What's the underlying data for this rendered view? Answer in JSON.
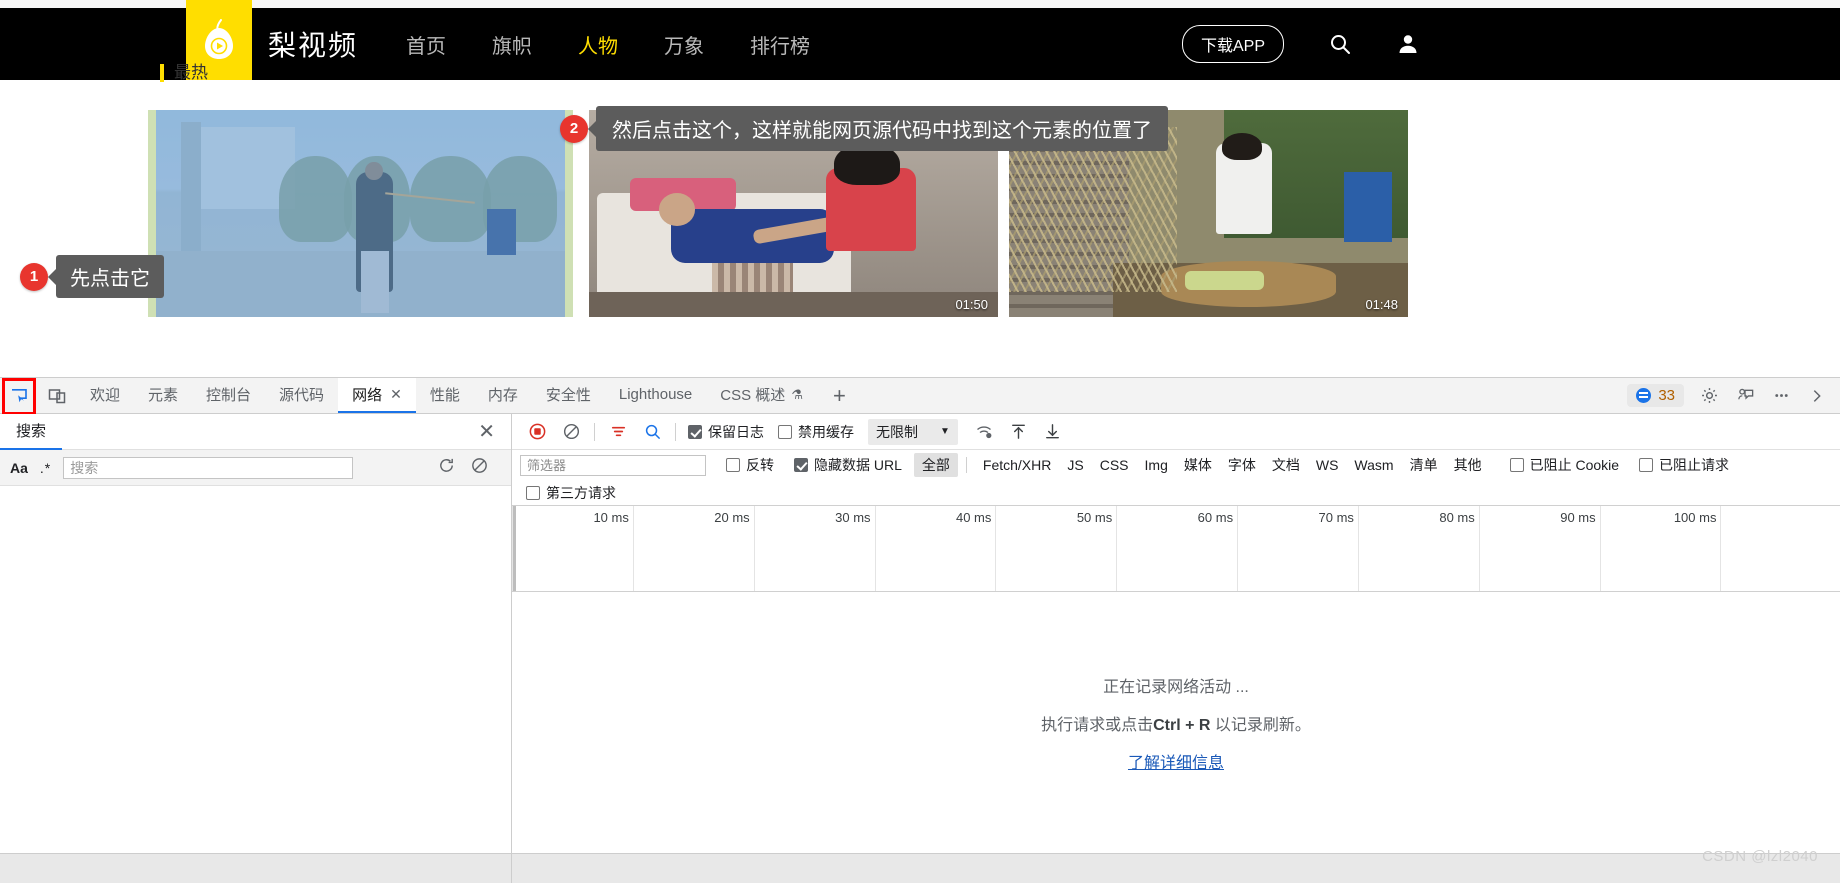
{
  "site": {
    "brand": "梨视频",
    "logo_icon": "pear-logo-icon",
    "nav": [
      {
        "label": "首页",
        "active": false
      },
      {
        "label": "旗帜",
        "active": false
      },
      {
        "label": "人物",
        "active": true
      },
      {
        "label": "万象",
        "active": false
      },
      {
        "label": "排行榜",
        "active": false
      }
    ],
    "download_app": "下载APP",
    "search_icon": "search-icon",
    "user_icon": "user-avatar-icon",
    "section_label": "最热",
    "thumbnails": [
      {
        "alt": "公园男子甩鞭视频缩略图",
        "duration": ""
      },
      {
        "alt": "照料卧床老人视频缩略图",
        "duration": "01:50"
      },
      {
        "alt": "农家院落男孩吃饭视频缩略图",
        "duration": "01:48"
      }
    ]
  },
  "annotations": [
    {
      "number": "1",
      "text": "先点击它"
    },
    {
      "number": "2",
      "text": "然后点击这个，这样就能网页源代码中找到这个元素的位置了"
    }
  ],
  "devtools": {
    "inspect_icon": "inspect-element-icon",
    "device_icon": "device-toolbar-icon",
    "tabs": [
      {
        "label": "欢迎",
        "active": false,
        "closable": false
      },
      {
        "label": "元素",
        "active": false,
        "closable": false
      },
      {
        "label": "控制台",
        "active": false,
        "closable": false
      },
      {
        "label": "源代码",
        "active": false,
        "closable": false
      },
      {
        "label": "网络",
        "active": true,
        "closable": true,
        "close_glyph": "✕"
      },
      {
        "label": "性能",
        "active": false,
        "closable": false
      },
      {
        "label": "内存",
        "active": false,
        "closable": false
      },
      {
        "label": "安全性",
        "active": false,
        "closable": false
      },
      {
        "label": "Lighthouse",
        "active": false,
        "closable": false
      },
      {
        "label": "CSS 概述",
        "active": false,
        "closable": false,
        "flask": "⚗"
      }
    ],
    "add_tab_glyph": "+",
    "issues": {
      "count": "33",
      "icon": "issues-bubble-icon"
    },
    "settings_icon": "gear-icon",
    "feedback_icon": "feedback-icon",
    "more_icon": "more-options-icon",
    "close_devtools_icon": "close-devtools-icon",
    "search_panel": {
      "tab_label": "搜索",
      "close_glyph": "✕",
      "match_case_label": "Aa",
      "regex_label": ".*",
      "input_value": "",
      "input_placeholder": "搜索",
      "refresh_icon": "refresh-icon",
      "clear_icon": "clear-icon"
    },
    "network": {
      "record_icon": "record-stop-icon",
      "clear_icon": "clear-icon",
      "filter_icon": "filter-icon",
      "search_icon": "search-icon",
      "preserve_log": {
        "label": "保留日志",
        "checked": true
      },
      "disable_cache": {
        "label": "禁用缓存",
        "checked": false
      },
      "throttling": {
        "value": "无限制",
        "chevron": "▼"
      },
      "network_conditions_icon": "network-conditions-icon",
      "import_har_icon": "import-har-icon",
      "export_har_icon": "export-har-icon",
      "filter_input_value": "",
      "filter_input_placeholder": "筛选器",
      "invert": {
        "label": "反转",
        "checked": false
      },
      "hide_data_urls": {
        "label": "隐藏数据 URL",
        "checked": true
      },
      "types": [
        {
          "label": "全部",
          "active": true
        },
        {
          "label": "Fetch/XHR",
          "active": false
        },
        {
          "label": "JS",
          "active": false
        },
        {
          "label": "CSS",
          "active": false
        },
        {
          "label": "Img",
          "active": false
        },
        {
          "label": "媒体",
          "active": false
        },
        {
          "label": "字体",
          "active": false
        },
        {
          "label": "文档",
          "active": false
        },
        {
          "label": "WS",
          "active": false
        },
        {
          "label": "Wasm",
          "active": false
        },
        {
          "label": "清单",
          "active": false
        },
        {
          "label": "其他",
          "active": false
        }
      ],
      "blocked_cookies": {
        "label": "已阻止 Cookie",
        "checked": false
      },
      "blocked_requests": {
        "label": "已阻止请求",
        "checked": false
      },
      "third_party": {
        "label": "第三方请求",
        "checked": false
      },
      "timeline_ticks": [
        "10 ms",
        "20 ms",
        "30 ms",
        "40 ms",
        "50 ms",
        "60 ms",
        "70 ms",
        "80 ms",
        "90 ms",
        "100 ms"
      ],
      "empty_state": {
        "line1": "正在记录网络活动 ...",
        "line2_prefix": "执行请求或点击",
        "line2_shortcut": "Ctrl + R",
        "line2_suffix": " 以记录刷新。",
        "link": "了解详细信息"
      }
    }
  },
  "watermark": "CSDN @lzl2040",
  "colors": {
    "brand_yellow": "#ffde00",
    "accent_blue": "#1a73e8",
    "callout_red": "#e8352e",
    "callout_bubble": "#5c5c5c",
    "highlight_box": "#ff0000"
  }
}
